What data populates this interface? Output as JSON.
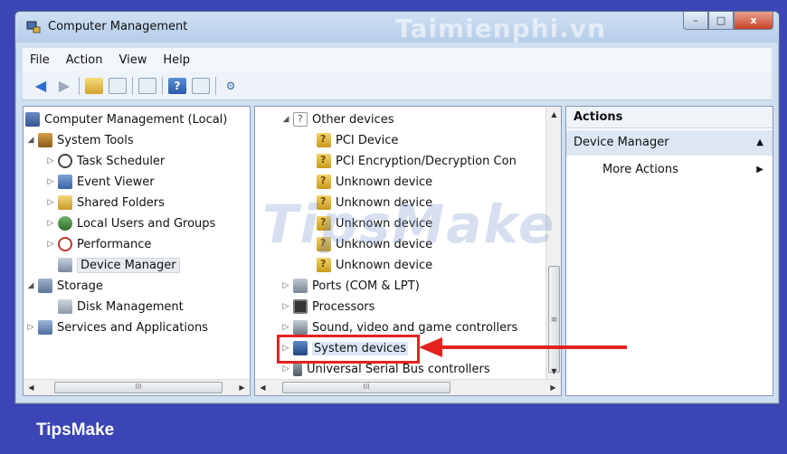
{
  "window": {
    "title": "Computer Management",
    "watermark_top": "Taimienphi.vn",
    "watermark_mid": "TipsMake",
    "caption": {
      "minimize": "–",
      "maximize": "□",
      "close": "x"
    }
  },
  "menubar": {
    "items": [
      "File",
      "Action",
      "View",
      "Help"
    ]
  },
  "toolbar": {
    "icons": [
      "back-icon",
      "forward-icon",
      "up-folder-icon",
      "show-hide-tree-icon",
      "properties-icon",
      "help-icon",
      "show-hide-action-pane-icon",
      "device-scan-icon"
    ]
  },
  "left_tree": {
    "root": "Computer Management (Local)",
    "system_tools": "System Tools",
    "task_scheduler": "Task Scheduler",
    "event_viewer": "Event Viewer",
    "shared_folders": "Shared Folders",
    "local_users": "Local Users and Groups",
    "performance": "Performance",
    "device_manager": "Device Manager",
    "storage": "Storage",
    "disk_management": "Disk Management",
    "services_apps": "Services and Applications"
  },
  "device_tree": {
    "other_devices": "Other devices",
    "pci_device": "PCI Device",
    "pci_encryption": "PCI Encryption/Decryption Con",
    "unknown_1": "Unknown device",
    "unknown_2": "Unknown device",
    "unknown_3": "Unknown device",
    "unknown_4": "Unknown device",
    "unknown_5": "Unknown device",
    "ports": "Ports (COM & LPT)",
    "processors": "Processors",
    "sound": "Sound, video and game controllers",
    "system_devices": "System devices",
    "usb": "Universal Serial Bus controllers"
  },
  "scroll": {
    "h_left_grip": "III",
    "h_mid_grip": "III",
    "v_mid_grip": "≡"
  },
  "actions": {
    "header": "Actions",
    "section": "Device Manager",
    "more": "More Actions"
  },
  "footer": {
    "brand": "TipsMake"
  },
  "colors": {
    "annotation": "#e4231f",
    "background": "#3b45b5"
  }
}
